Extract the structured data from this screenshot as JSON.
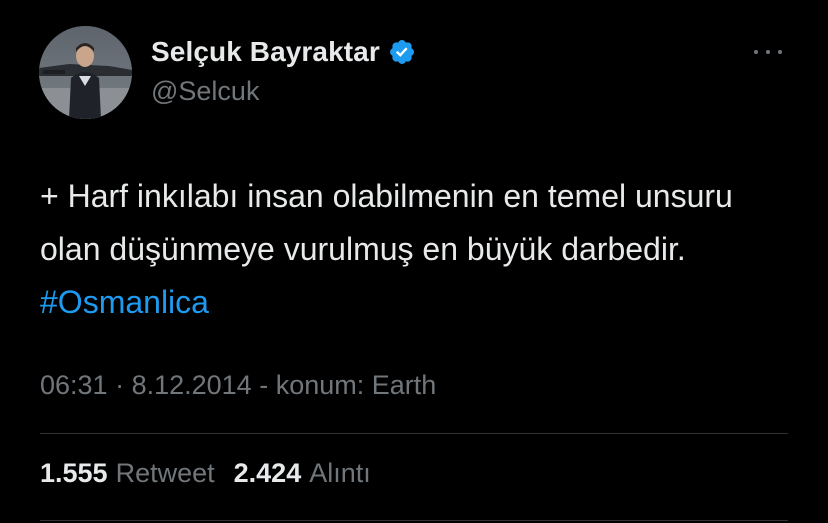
{
  "author": {
    "display_name": "Selçuk Bayraktar",
    "handle": "@Selcuk",
    "verified": true,
    "avatar_icon": "profile-photo"
  },
  "tweet": {
    "text_before_hashtag": "+ Harf inkılabı insan olabilmenin en temel unsuru olan düşünmeye vurulmuş en büyük darbedir. ",
    "hashtag": "#Osmanlica",
    "time": "06:31",
    "separator": " · ",
    "date": "8.12.2014",
    "location_prefix": " - konum: ",
    "location": "Earth"
  },
  "stats": {
    "retweets_count": "1.555",
    "retweets_label": "Retweet",
    "quotes_count": "2.424",
    "quotes_label": "Alıntı"
  },
  "colors": {
    "background": "#000000",
    "primary_text": "#e7e9ea",
    "secondary_text": "#71767b",
    "accent": "#1d9bf0",
    "divider": "#2f3336"
  },
  "icons": {
    "verified": "verified-badge-icon",
    "more": "more-horizontal-icon"
  }
}
